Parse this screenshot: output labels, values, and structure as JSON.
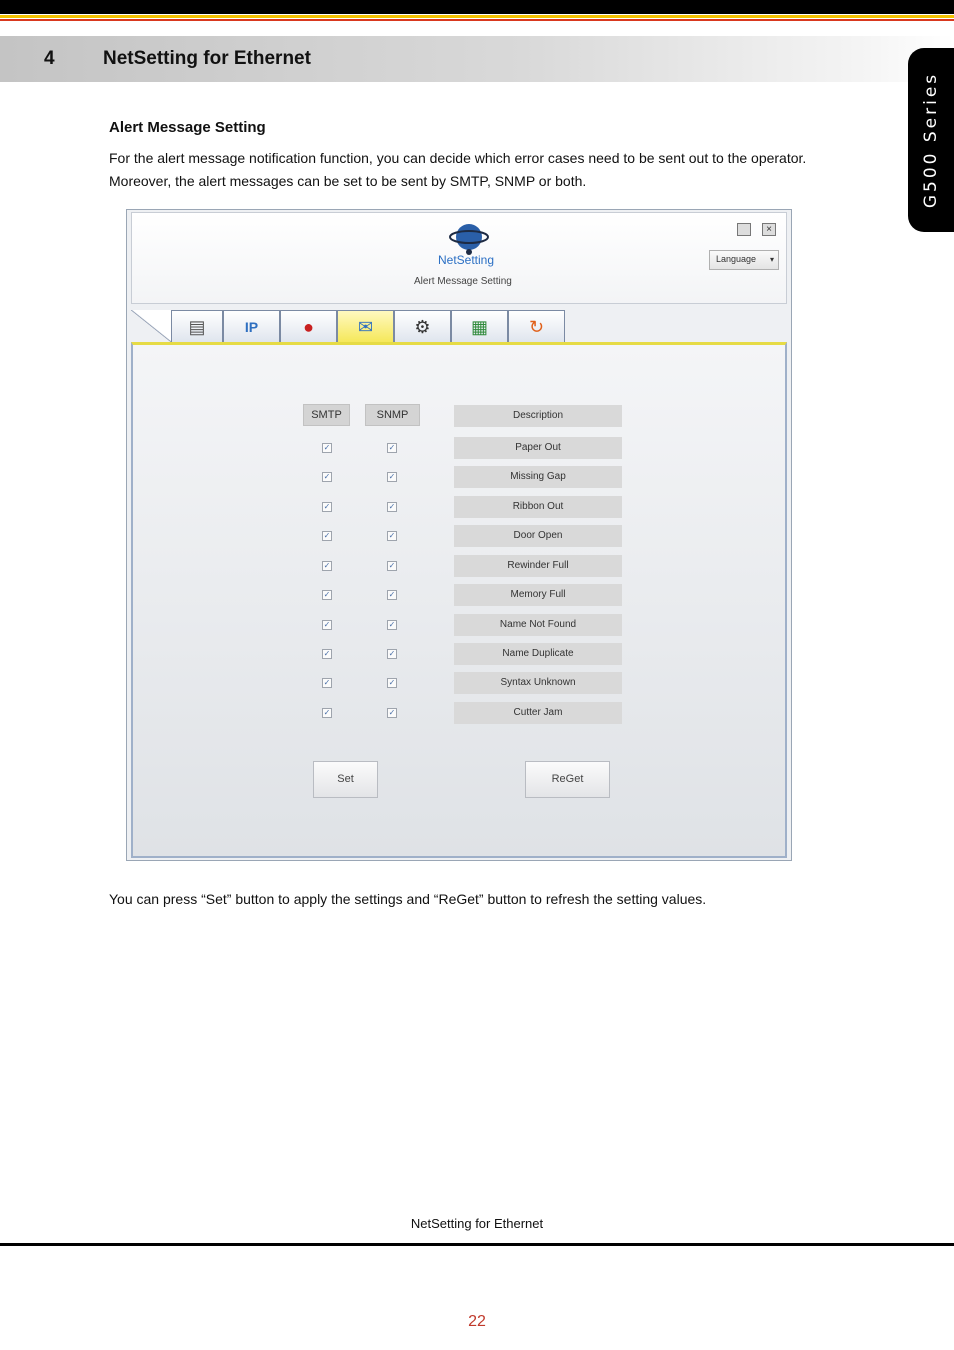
{
  "section": {
    "number": "4",
    "title": "NetSetting for Ethernet"
  },
  "side_tab": {
    "text": "G500 Series"
  },
  "content": {
    "subheading": "Alert Message Setting",
    "paragraph1": "For the alert message notification function, you can decide which error cases need to be sent out to the operator. Moreover, the alert messages can be set to be sent by SMTP, SNMP or both.",
    "paragraph2": "You can press “Set” button to apply the settings and “ReGet” button to refresh the setting values."
  },
  "window": {
    "logo_text": "NetSetting",
    "subtitle": "Alert Message Setting",
    "language_label": "Language",
    "tabs": [
      {
        "icon": "printer-icon",
        "glyph": "▤"
      },
      {
        "icon": "ip-icon",
        "glyph": "IP"
      },
      {
        "icon": "alert-bell-icon",
        "glyph": "●"
      },
      {
        "icon": "mail-alert-icon",
        "glyph": "✉"
      },
      {
        "icon": "tools-icon",
        "glyph": "⚙"
      },
      {
        "icon": "config-icon",
        "glyph": "▦"
      },
      {
        "icon": "refresh-icon",
        "glyph": "↻"
      }
    ],
    "active_tab_index": 3,
    "columns": {
      "smtp": "SMTP",
      "snmp": "SNMP",
      "description": "Description"
    },
    "alerts": [
      {
        "description": "Paper Out",
        "smtp": true,
        "snmp": true
      },
      {
        "description": "Missing Gap",
        "smtp": true,
        "snmp": true
      },
      {
        "description": "Ribbon Out",
        "smtp": true,
        "snmp": true
      },
      {
        "description": "Door Open",
        "smtp": true,
        "snmp": true
      },
      {
        "description": "Rewinder Full",
        "smtp": true,
        "snmp": true
      },
      {
        "description": "Memory Full",
        "smtp": true,
        "snmp": true
      },
      {
        "description": "Name Not Found",
        "smtp": true,
        "snmp": true
      },
      {
        "description": "Name Duplicate",
        "smtp": true,
        "snmp": true
      },
      {
        "description": "Syntax Unknown",
        "smtp": true,
        "snmp": true
      },
      {
        "description": "Cutter Jam",
        "smtp": true,
        "snmp": true
      }
    ],
    "set_label": "Set",
    "reget_label": "ReGet"
  },
  "footer": {
    "text": "NetSetting for Ethernet",
    "page_number": "22"
  },
  "colors": {
    "accent_yellow": "#f2c200",
    "accent_red": "#d9381e",
    "page_number": "#c0392b"
  }
}
